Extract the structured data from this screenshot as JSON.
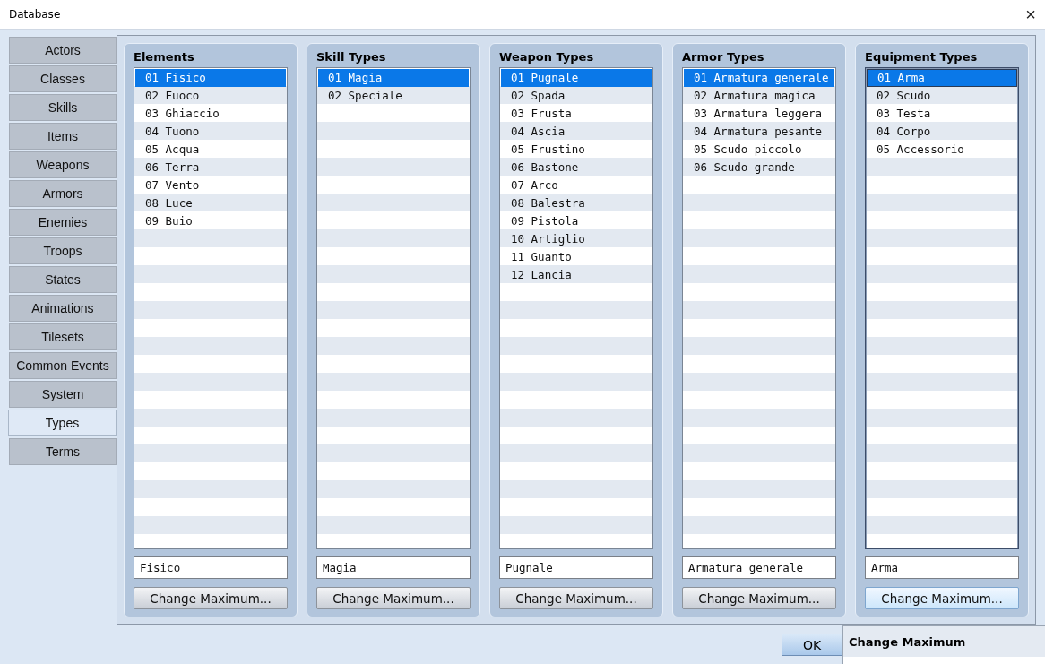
{
  "window": {
    "title": "Database",
    "close": "×"
  },
  "tabs": [
    {
      "label": "Actors",
      "selected": false
    },
    {
      "label": "Classes",
      "selected": false
    },
    {
      "label": "Skills",
      "selected": false
    },
    {
      "label": "Items",
      "selected": false
    },
    {
      "label": "Weapons",
      "selected": false
    },
    {
      "label": "Armors",
      "selected": false
    },
    {
      "label": "Enemies",
      "selected": false
    },
    {
      "label": "Troops",
      "selected": false
    },
    {
      "label": "States",
      "selected": false
    },
    {
      "label": "Animations",
      "selected": false
    },
    {
      "label": "Tilesets",
      "selected": false
    },
    {
      "label": "Common Events",
      "selected": false
    },
    {
      "label": "System",
      "selected": false
    },
    {
      "label": "Types",
      "selected": true
    },
    {
      "label": "Terms",
      "selected": false
    }
  ],
  "panels": [
    {
      "title": "Elements",
      "focused": false,
      "items": [
        {
          "text": "01 Fisico",
          "selected": true
        },
        {
          "text": "02 Fuoco",
          "selected": false
        },
        {
          "text": "03 Ghiaccio",
          "selected": false
        },
        {
          "text": "04 Tuono",
          "selected": false
        },
        {
          "text": "05 Acqua",
          "selected": false
        },
        {
          "text": "06 Terra",
          "selected": false
        },
        {
          "text": "07 Vento",
          "selected": false
        },
        {
          "text": "08 Luce",
          "selected": false
        },
        {
          "text": "09 Buio",
          "selected": false
        }
      ],
      "field": "Fisico",
      "button": {
        "label": "Change Maximum...",
        "hovered": false
      }
    },
    {
      "title": "Skill Types",
      "focused": false,
      "items": [
        {
          "text": "01 Magia",
          "selected": true
        },
        {
          "text": "02 Speciale",
          "selected": false
        }
      ],
      "field": "Magia",
      "button": {
        "label": "Change Maximum...",
        "hovered": false
      }
    },
    {
      "title": "Weapon Types",
      "focused": false,
      "items": [
        {
          "text": "01 Pugnale",
          "selected": true
        },
        {
          "text": "02 Spada",
          "selected": false
        },
        {
          "text": "03 Frusta",
          "selected": false
        },
        {
          "text": "04 Ascia",
          "selected": false
        },
        {
          "text": "05 Frustino",
          "selected": false
        },
        {
          "text": "06 Bastone",
          "selected": false
        },
        {
          "text": "07 Arco",
          "selected": false
        },
        {
          "text": "08 Balestra",
          "selected": false
        },
        {
          "text": "09 Pistola",
          "selected": false
        },
        {
          "text": "10 Artiglio",
          "selected": false
        },
        {
          "text": "11 Guanto",
          "selected": false
        },
        {
          "text": "12 Lancia",
          "selected": false
        }
      ],
      "field": "Pugnale",
      "button": {
        "label": "Change Maximum...",
        "hovered": false
      }
    },
    {
      "title": "Armor Types",
      "focused": false,
      "items": [
        {
          "text": "01 Armatura generale",
          "selected": true
        },
        {
          "text": "02 Armatura magica",
          "selected": false
        },
        {
          "text": "03 Armatura leggera",
          "selected": false
        },
        {
          "text": "04 Armatura pesante",
          "selected": false
        },
        {
          "text": "05 Scudo piccolo",
          "selected": false
        },
        {
          "text": "06 Scudo grande",
          "selected": false
        }
      ],
      "field": "Armatura generale",
      "button": {
        "label": "Change Maximum...",
        "hovered": false
      }
    },
    {
      "title": "Equipment Types",
      "focused": true,
      "items": [
        {
          "text": "01 Arma",
          "selected": true
        },
        {
          "text": "02 Scudo",
          "selected": false
        },
        {
          "text": "03 Testa",
          "selected": false
        },
        {
          "text": "04 Corpo",
          "selected": false
        },
        {
          "text": "05 Accessorio",
          "selected": false
        }
      ],
      "field": "Arma",
      "button": {
        "label": "Change Maximum...",
        "hovered": true
      }
    }
  ],
  "ok_button": "OK",
  "tooltip": {
    "title": "Change Maximum"
  }
}
